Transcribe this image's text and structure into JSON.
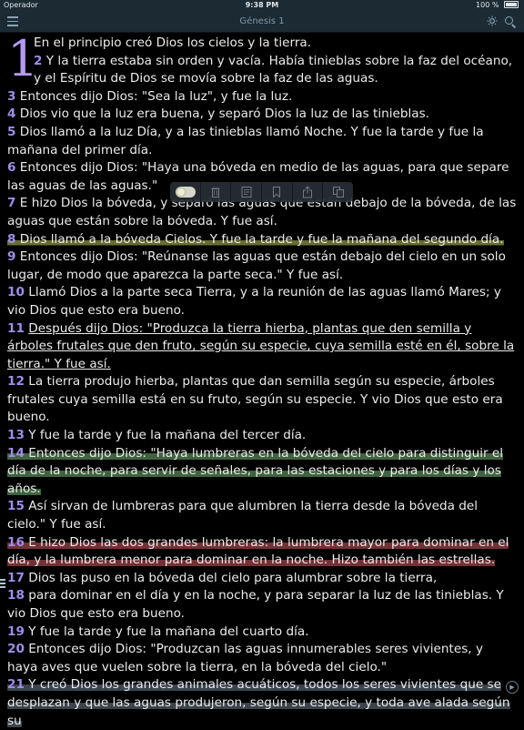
{
  "status": {
    "carrier": "Operador",
    "time": "9:38 PM",
    "battery": "100 %"
  },
  "nav": {
    "title": "Génesis 1"
  },
  "icons": {
    "menu": "hamburger-icon",
    "brightness": "sun-icon",
    "search": "magnifier-icon"
  },
  "toolbar": {
    "items": [
      "highlight-toggle",
      "trash-icon",
      "note-icon",
      "bookmark-icon",
      "share-icon",
      "copy-icon"
    ]
  },
  "chapter": {
    "dropcap": "1",
    "verses": [
      {
        "n": "",
        "text": "En el principio creó Dios los cielos y la tierra."
      },
      {
        "n": "2",
        "text": "Y la tierra estaba sin orden y vacía. Había tinieblas sobre la faz del océano, y el Espíritu de Dios se movía sobre la faz de las aguas."
      },
      {
        "n": "3",
        "text": "Entonces dijo Dios: \"Sea la luz\", y fue la luz."
      },
      {
        "n": "4",
        "text": "Dios vio que la luz era buena, y separó Dios la luz de las tinieblas."
      },
      {
        "n": "5",
        "text": "Dios llamó a la luz Día, y a las tinieblas llamó Noche. Y fue la tarde y fue la mañana del primer día."
      },
      {
        "n": "6",
        "text": "Entonces dijo Dios: \"Haya una bóveda en medio de las aguas, para que separe las aguas de las aguas.\""
      },
      {
        "n": "7",
        "text": "E hizo Dios la bóveda, y separó las aguas que están debajo de la bóveda, de las aguas que están sobre la bóveda. Y fue así."
      },
      {
        "n": "8",
        "text": "Dios llamó a la bóveda Cielos. Y fue la tarde y fue la mañana del segundo día."
      },
      {
        "n": "9",
        "text": "Entonces dijo Dios: \"Reúnanse las aguas que están debajo del cielo en un solo lugar, de modo que aparezca la parte seca.\" Y fue así."
      },
      {
        "n": "10",
        "text": "Llamó Dios a la parte seca Tierra, y a la reunión de las aguas llamó Mares; y vio Dios que esto era bueno."
      },
      {
        "n": "11",
        "text": "Después dijo Dios: \"Produzca la tierra hierba, plantas que den semilla y árboles frutales que den fruto, según su especie, cuya semilla esté en él, sobre la tierra.\" Y fue así."
      },
      {
        "n": "12",
        "text": "La tierra produjo hierba, plantas que dan semilla según su especie, árboles frutales cuya semilla está en su fruto, según su especie. Y vio Dios que esto era bueno."
      },
      {
        "n": "13",
        "text": "Y fue la tarde y fue la mañana del tercer día."
      },
      {
        "n": "14",
        "text": "Entonces dijo Dios: \"Haya lumbreras en la bóveda del cielo para distinguir el día de la noche, para servir de señales, para las estaciones y para los días y los años."
      },
      {
        "n": "15",
        "text": "Así sirvan de lumbreras para que alumbren la tierra desde la bóveda del cielo.\" Y fue así."
      },
      {
        "n": "16",
        "text": "E hizo Dios las dos grandes lumbreras: la lumbrera mayor para dominar en el día, y la lumbrera menor para dominar en la noche. Hizo también las estrellas."
      },
      {
        "n": "17",
        "text": "Dios las puso en la bóveda del cielo para alumbrar sobre la tierra,"
      },
      {
        "n": "18",
        "text": "para dominar en el día y en la noche, y para separar la luz de las tinieblas. Y vio Dios que esto era bueno."
      },
      {
        "n": "19",
        "text": "Y fue la tarde y fue la mañana del cuarto día."
      },
      {
        "n": "20",
        "text": "Entonces dijo Dios: \"Produzcan las aguas innumerables seres vivientes, y haya aves que vuelen sobre la tierra, en la bóveda del cielo.\""
      },
      {
        "n": "21",
        "text": "Y creó Dios los grandes animales acuáticos, todos los seres vivientes que se desplazan y que las aguas produjeron, según su especie, y toda ave alada según su"
      }
    ]
  },
  "colors": {
    "background": "#000000",
    "bar": "#1c2a33",
    "verse_number": "#9f8ee8",
    "dropcap": "#b69bf0",
    "highlight_yellow": "#78803c",
    "highlight_green": "#466e46",
    "highlight_red": "#7d373c"
  }
}
